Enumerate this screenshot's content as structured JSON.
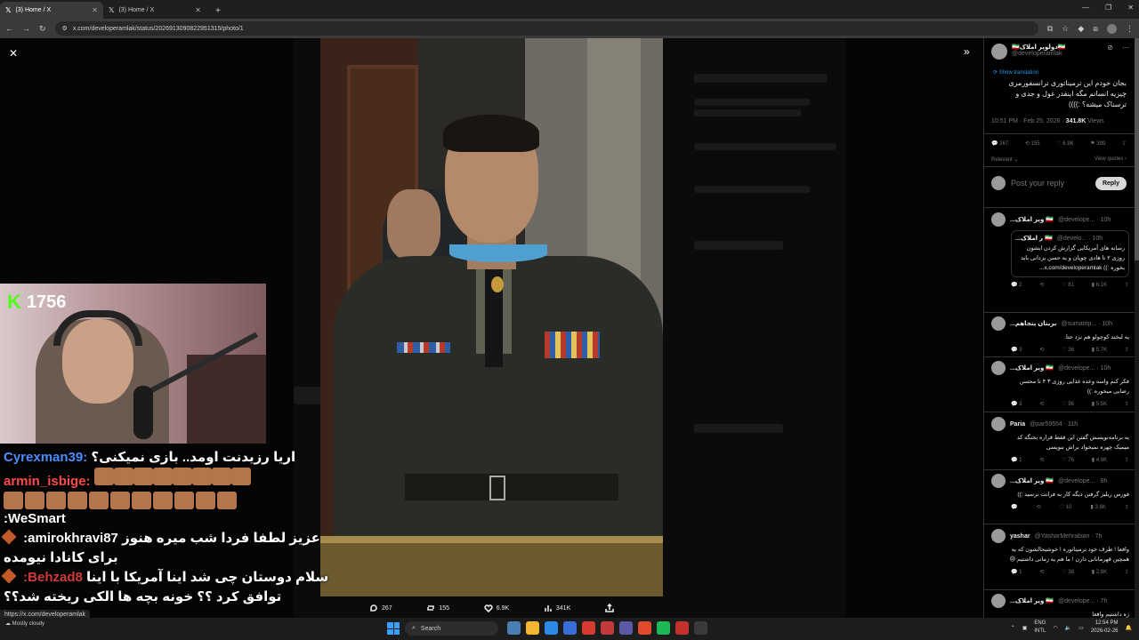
{
  "browser": {
    "tabs": [
      {
        "title": "(3) Home / X",
        "active": true
      },
      {
        "title": "(3) Home / X",
        "active": false
      }
    ],
    "url": "x.com/developeramlak/status/2026913090822951315/photo/1"
  },
  "viewer": {
    "actions": {
      "replies": "267",
      "reposts": "155",
      "likes": "6.9K",
      "views": "341K"
    }
  },
  "stream": {
    "follower_count": "1756",
    "chat": [
      {
        "user": "Cyrexman39:",
        "msg": "اریا رزیدنت اومد.. بازی نمیکنی؟",
        "color": "#4c8cff"
      },
      {
        "user": "armin_isbige:",
        "msg": "",
        "color": "#ff4a4a"
      },
      {
        "user": ":WeSmart",
        "msg": "",
        "color": "#ffffff"
      },
      {
        "user": ":amirokhravi87",
        "msg": "عزیز لطفا فردا شب میره هنوز",
        "color": "#ffffff"
      },
      {
        "user": "",
        "msg": "برای کانادا نیومده",
        "color": "#ffffff"
      },
      {
        "user": ":Behzad8",
        "msg": "سلام دوستان چی شد اینا آمریکا با اینا",
        "color": "#d23b3b"
      },
      {
        "user": "",
        "msg": "توافق کرد ؟؟ خونه بچه ها الکی ریخته شد؟؟",
        "color": "#ffffff"
      }
    ]
  },
  "status_link": "https://x.com/developeramlak",
  "panel": {
    "author_name": "🇮🇷دولوپر املاک🇮🇷",
    "author_handle": "@developeramlak",
    "show_translation": "Show translation",
    "post_text": "بجان خودم این ترمیناتوری ترانسفورمری چیزیه انسانم مگه اینقدر غول و جدی و ترسناک میشه؟ :))))",
    "time": "10:51 PM · Feb 25, 2026 · ",
    "views": "341.8K",
    "views_label": "Views",
    "stats": {
      "replies": "267",
      "reposts": "155",
      "likes": "6.9K",
      "bookmarks": "399"
    },
    "sort": "Relevant",
    "view_quotes": "View quotes",
    "reply_placeholder": "Post your reply",
    "reply_button": "Reply",
    "replies": [
      {
        "name": "...ویر املاک 🇮🇷",
        "handle": "@develope... · 10h",
        "quote_name": "...ر املاک 🇮🇷",
        "quote_handle": "@develo... · 10h",
        "quote_text": "رسانه های آمریکایی گزارش کردن ایشون روزی ۲ تا هادی چوپان و یه حسن یزدانی باید بخوره :)) x.com/developeramlak...",
        "stats": {
          "r": "2",
          "rp": "",
          "l": "81",
          "v": "6.1K"
        }
      },
      {
        "name": "...بریتان پنجاهم",
        "handle": "@sumatrip... · 10h",
        "text": "یه لبخند کوچولو هم نزد حتا.",
        "stats": {
          "r": "3",
          "rp": "",
          "l": "36",
          "v": "5.7K"
        }
      },
      {
        "name": "...ویر املاک 🇮🇷",
        "handle": "@develope... · 10h",
        "text": "فکر کنم واسه وعده غذایی روزی ۳ ۴ تا محسن رضایی میخوره :))",
        "stats": {
          "r": "3",
          "rp": "",
          "l": "96",
          "v": "5.5K"
        }
      },
      {
        "name": "Paria",
        "handle": "@par59554 · 11h",
        "text": "یه برنامه‌نویسش گفتن این فقط قراره بجنگه کد میمیک چهره نمیخواد براش بنویسی",
        "stats": {
          "r": "1",
          "rp": "",
          "l": "76",
          "v": "4.9K"
        }
      },
      {
        "name": "...ویر املاک 🇮🇷",
        "handle": "@develope... · 8h",
        "text": "فورس ریلیز گرفتن دیگه کار به فرانت نرسید :))",
        "stats": {
          "r": "",
          "rp": "",
          "l": "10",
          "v": "3.6K"
        }
      },
      {
        "name": "yashar",
        "handle": "@YasharMehrabian · 7h",
        "text": "واقعا ! طرف خود ترمیناتوره ! خوشبحالشون که یه همچین قهرمانانی دارن ! ما هم یه زمانی داشتیم 😢",
        "stats": {
          "r": "1",
          "rp": "",
          "l": "38",
          "v": "2.8K"
        }
      },
      {
        "name": "...ویر املاک 🇮🇷",
        "handle": "@develope... · 7h",
        "text": "زه داشتیم واقعا",
        "stats": {
          "r": "",
          "rp": "",
          "l": "",
          "v": ""
        }
      }
    ]
  },
  "taskbar": {
    "weather": "Mostly cloudy",
    "search": "Search",
    "lang": "ENG",
    "lang2": "INTL",
    "time": "12:54 PM",
    "date": "2026-02-26"
  }
}
